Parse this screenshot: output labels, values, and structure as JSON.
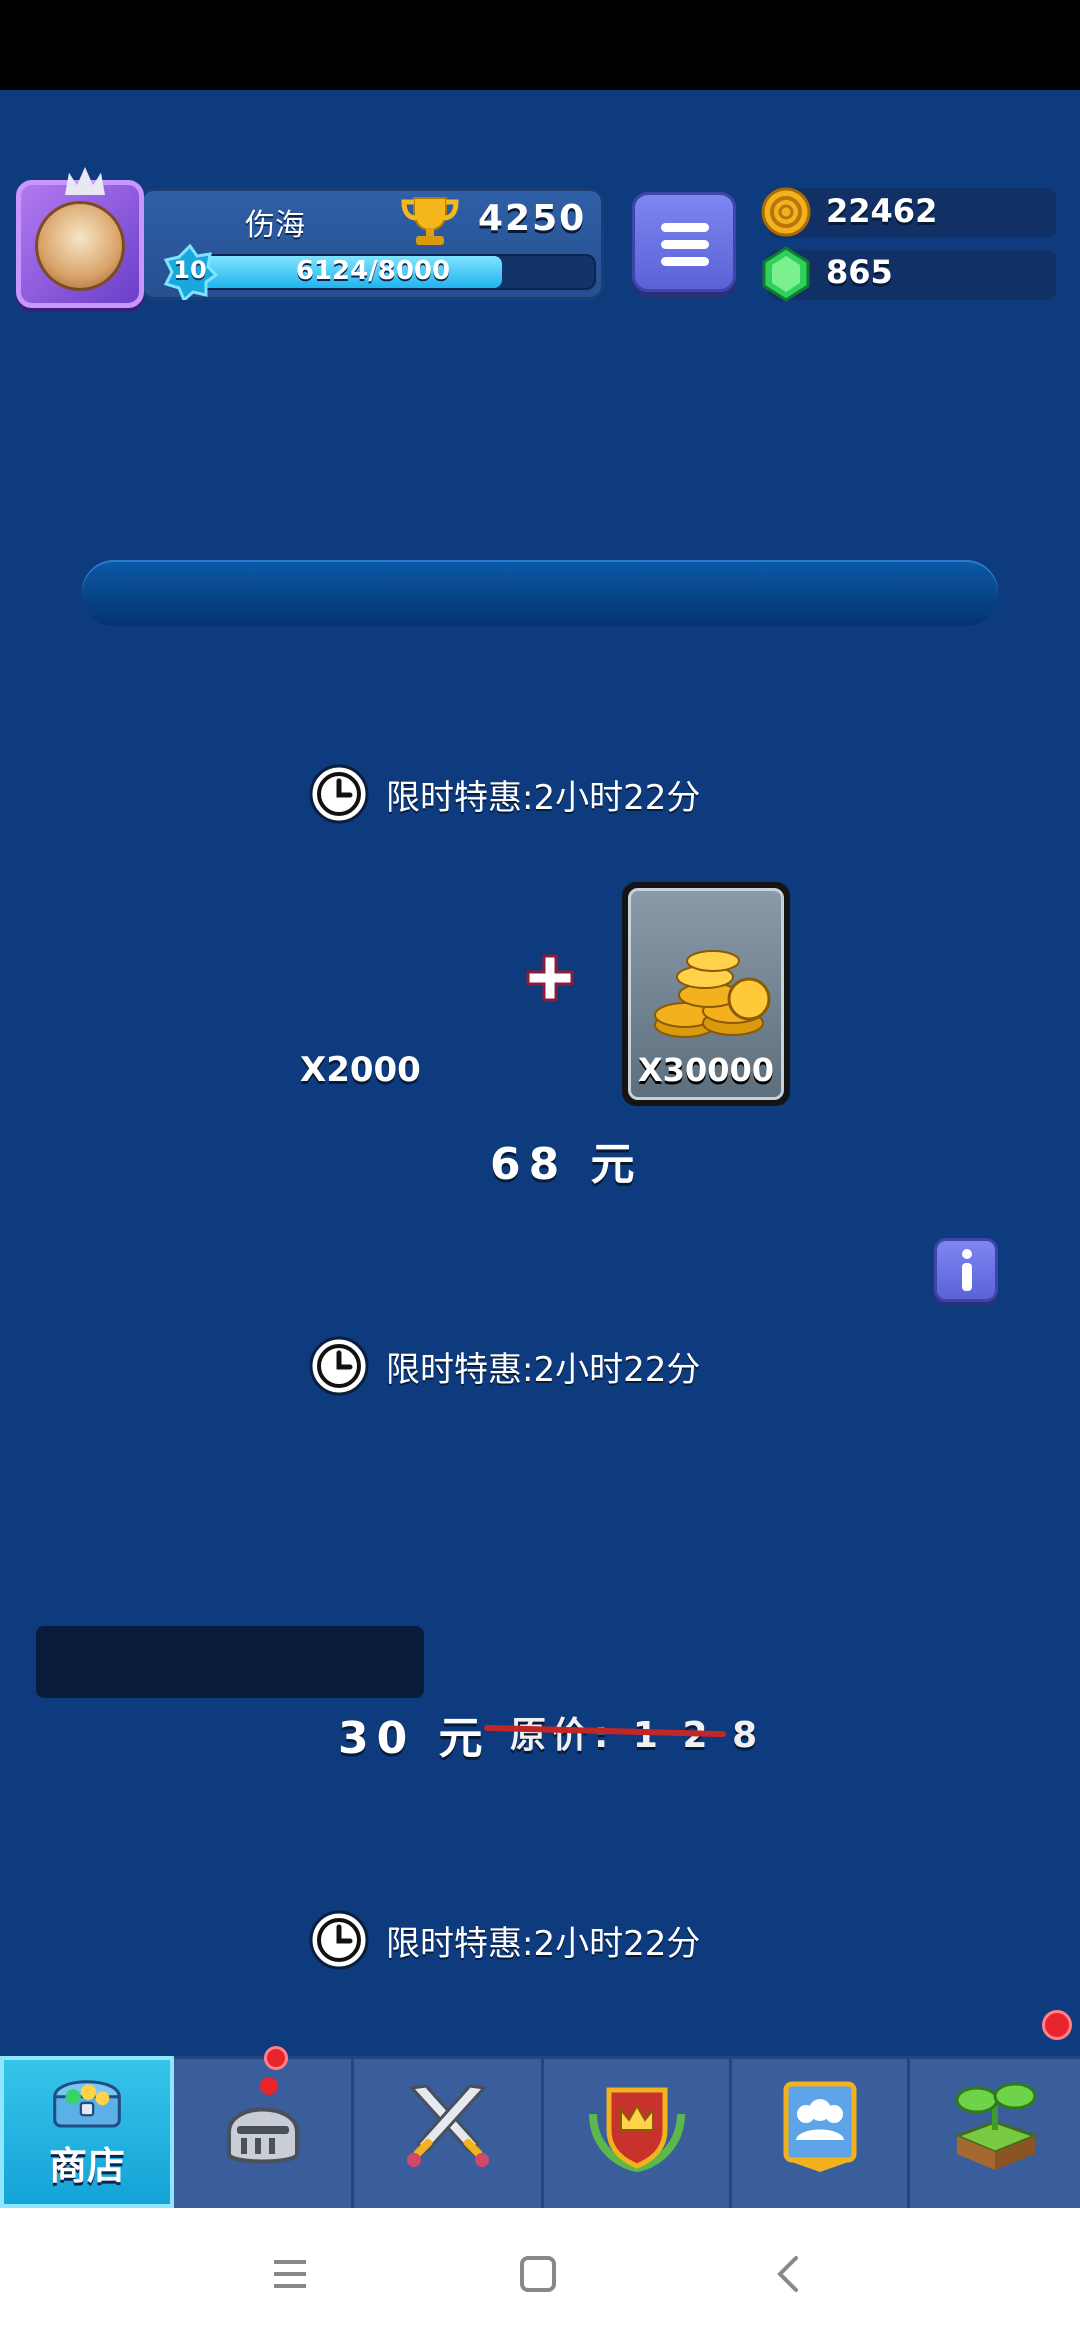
{
  "player": {
    "name": "伤海",
    "trophies": "4250",
    "level": "10",
    "xp_text": "6124/8000",
    "xp_progress": 0.77
  },
  "currency": {
    "gold": "22462",
    "gems": "865"
  },
  "offers": [
    {
      "timer": "限时特惠:2小时22分"
    },
    {
      "timer": "限时特惠:2小时22分"
    },
    {
      "timer": "限时特惠:2小时22分"
    }
  ],
  "bundle": {
    "gem_qty": "X2000",
    "coin_qty": "X30000",
    "price": "68 元"
  },
  "deal": {
    "price": "30 元",
    "original_price": "原价: 1 2 8"
  },
  "nav": {
    "shop_label": "商店"
  },
  "colors": {
    "background": "#0d3b7e",
    "accent": "#21b4ee",
    "button": "#6a73e4"
  }
}
